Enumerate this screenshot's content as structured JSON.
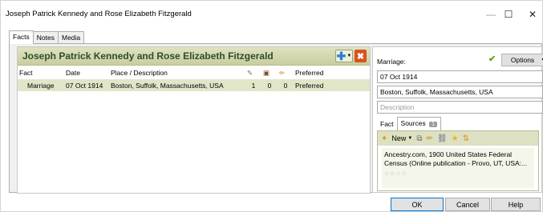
{
  "window": {
    "title": "Joseph Patrick Kennedy and Rose Elizabeth Fitzgerald",
    "minimize": "—",
    "maximize": "☐",
    "close": "✕"
  },
  "tabs": [
    {
      "label": "Facts"
    },
    {
      "label": "Notes"
    },
    {
      "label": "Media"
    }
  ],
  "header": {
    "name": "Joseph Patrick Kennedy and Rose Elizabeth Fitzgerald"
  },
  "table": {
    "columns": {
      "fact": "Fact",
      "date": "Date",
      "place": "Place / Description",
      "preferred": "Preferred"
    },
    "rows": [
      {
        "fact": "Marriage",
        "date": "07 Oct 1914",
        "place": "Boston, Suffolk, Massachusetts, USA",
        "sources": "1",
        "media": "0",
        "notes": "0",
        "preferred": "Preferred"
      }
    ]
  },
  "detail": {
    "label": "Marriage:",
    "options_label": "Options",
    "date_value": "07 Oct 1914",
    "place_value": "Boston, Suffolk, Massachusetts, USA",
    "description_placeholder": "Description",
    "subtabs": {
      "fact": "Fact",
      "sources": "Sources",
      "sources_count": "1"
    },
    "toolbar": {
      "new_label": "New"
    },
    "source_item": {
      "text": "Ancestry.com, 1900 United States Federal Census (Online publication - Provo, UT, USA:..."
    }
  },
  "footer": {
    "ok": "OK",
    "cancel": "Cancel",
    "help": "Help"
  },
  "colors": {
    "header_text": "#2b4f2c",
    "header_bg": "#d3d7ae",
    "selected_row": "#e2e6c9",
    "delete": "#d9531e",
    "add": "#2e7fd4",
    "check": "#6aa318"
  }
}
